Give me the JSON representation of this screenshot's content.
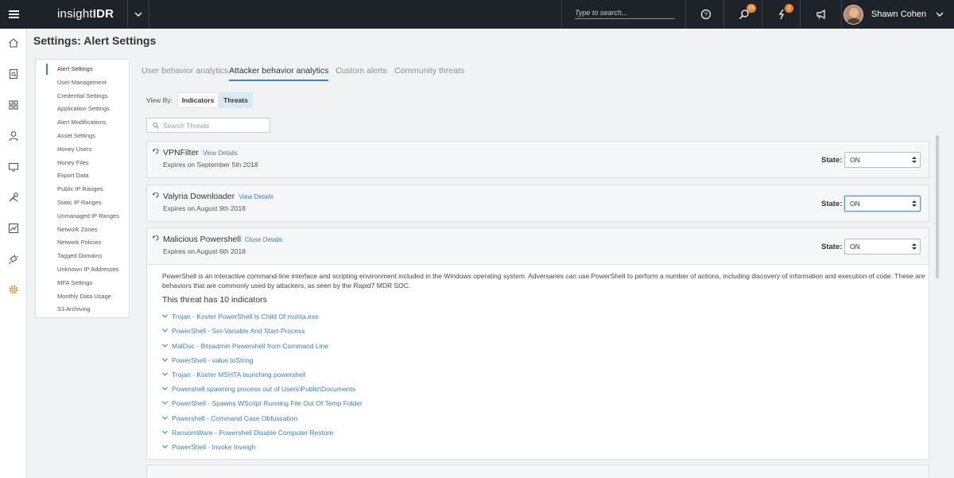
{
  "app": {
    "logo_prefix": "insight",
    "logo_suffix": "IDR",
    "search_placeholder": "Type to search...",
    "notifications": {
      "investigations_count": "15",
      "alerts_count": "2"
    },
    "user_name": "Shawn Cohen"
  },
  "left_nav": [
    "home-icon",
    "report-icon",
    "dashboard-icon",
    "user-icon",
    "monitor-icon",
    "tools-icon",
    "chart-icon",
    "plug-icon",
    "gear-icon"
  ],
  "page_title": "Settings: Alert Settings",
  "settings_menu": [
    "Alert Settings",
    "User Management",
    "Credential Settings",
    "Application Settings",
    "Alert Modifications",
    "Asset Settings",
    "Honey Users",
    "Honey Files",
    "Export Data",
    "Public IP Ranges",
    "Static IP Ranges",
    "Unmanaged IP Ranges",
    "Network Zones",
    "Network Policies",
    "Tagged Domains",
    "Unknown IP Addresses",
    "MFA Settings",
    "Monthly Data Usage",
    "S3 Archiving"
  ],
  "tabs": [
    "User behavior analytics",
    "Attacker behavior analytics",
    "Custom alerts",
    "Community threats"
  ],
  "view_by": {
    "label": "View By:",
    "options": [
      "Indicators",
      "Threats"
    ],
    "selected": "Threats"
  },
  "search_placeholder": "Search Threats",
  "state_label": "State:",
  "threats": [
    {
      "name": "VPNFilter",
      "link": "View Details",
      "expires": "Expires on September 5th 2018",
      "state": "ON"
    },
    {
      "name": "Valyria Downloader",
      "link": "View Details",
      "expires": "Expires on August 9th 2018",
      "state": "ON"
    },
    {
      "name": "Malicious Powershell",
      "link": "Close Details",
      "expires": "Expires on August 6th 2018",
      "state": "ON",
      "description": "PowerShell is an interactive command-line interface and scripting environment included in the Windows operating system. Adversaries can use PowerShell to perform a number of actions, including discovery of information and execution of code. These are behaviors that are commonly used by attackers, as seen by the Rapid7 MDR SOC.",
      "indicator_count_text": "This threat has 10 indicators",
      "indicators": [
        "Trojan - Kovter PowerShell Is Child Of mshta.exe",
        "PowerShell - Set-Variable And Start-Process",
        "MalDoc - Bitsadmin Powershell from Command Line",
        "PowerShell - value.toString",
        "Trojan - Kovter MSHTA launching powershell",
        "Powershell spawning process out of Users\\Public\\Documents",
        "PowerShell - Spawns WScript Running File Out Of Temp Folder",
        "Powershell - Command Case Obfuscation",
        "RansomWare - Powershell Disable Computer Restore",
        "PowerShell - Invoke Inveigh"
      ]
    }
  ],
  "colors": {
    "topbar": "#1e2329",
    "accent": "#3a82c4",
    "badge": "#e8892b"
  }
}
